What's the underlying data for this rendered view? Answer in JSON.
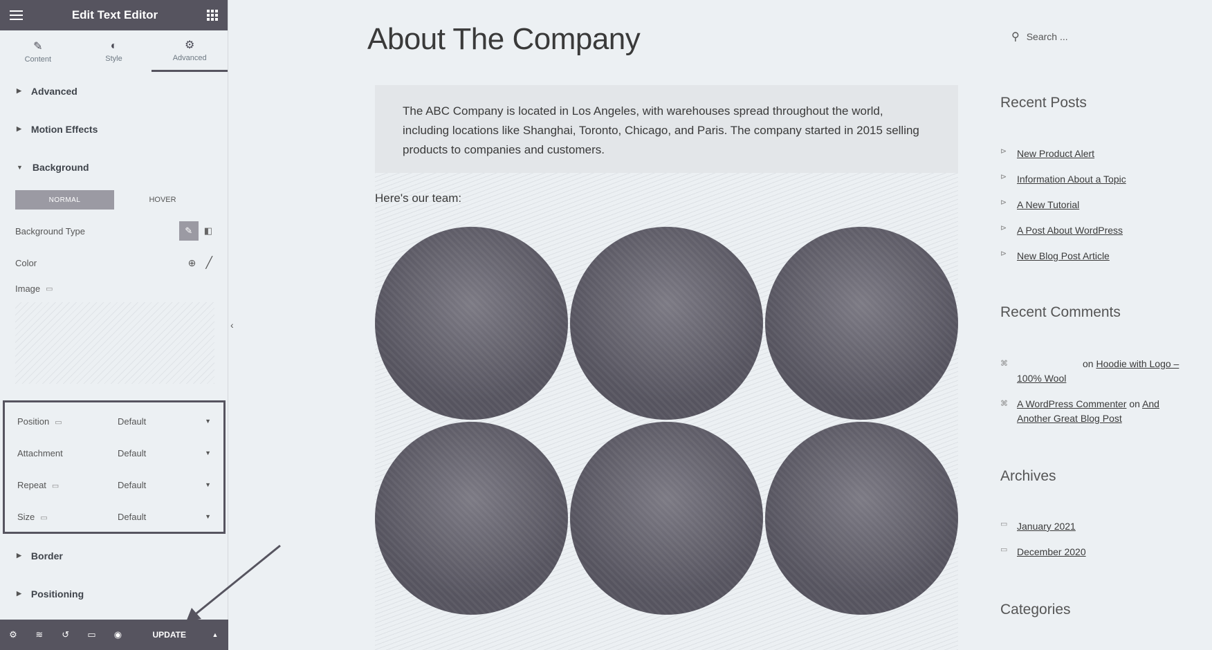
{
  "panel": {
    "title": "Edit Text Editor",
    "tabs": [
      {
        "label": "Content",
        "icon": "pencil-icon"
      },
      {
        "label": "Style",
        "icon": "half-circle-icon"
      },
      {
        "label": "Advanced",
        "icon": "gear-icon"
      }
    ],
    "sections_top": [
      "Advanced",
      "Motion Effects",
      "Background"
    ],
    "state_normal": "NORMAL",
    "state_hover": "HOVER",
    "background_type_label": "Background Type",
    "color_label": "Color",
    "image_label": "Image",
    "selects": [
      {
        "label": "Position",
        "value": "Default"
      },
      {
        "label": "Attachment",
        "value": "Default"
      },
      {
        "label": "Repeat",
        "value": "Default"
      },
      {
        "label": "Size",
        "value": "Default"
      }
    ],
    "sections_bottom": [
      "Border",
      "Positioning"
    ],
    "update_label": "UPDATE"
  },
  "main": {
    "title": "About The Company",
    "intro": "The ABC Company is located in Los Angeles, with warehouses spread throughout the world, including locations like Shanghai, Toronto, Chicago, and Paris. The company started in 2015 selling products to companies and customers.",
    "team_label": "Here's our team:"
  },
  "sidebar": {
    "search_placeholder": "Search ...",
    "recent_posts_heading": "Recent Posts",
    "recent_posts": [
      "New Product Alert",
      "Information About a Topic",
      "A New Tutorial",
      "A Post About WordPress",
      "New Blog Post Article"
    ],
    "recent_comments_heading": "Recent Comments",
    "comment1_on": "on",
    "comment1_post": "Hoodie with Logo – 100% Wool",
    "comment2_author": "A WordPress Commenter",
    "comment2_on": "on",
    "comment2_post": "And Another Great Blog Post",
    "archives_heading": "Archives",
    "archives": [
      "January 2021",
      "December 2020"
    ],
    "categories_heading": "Categories"
  }
}
